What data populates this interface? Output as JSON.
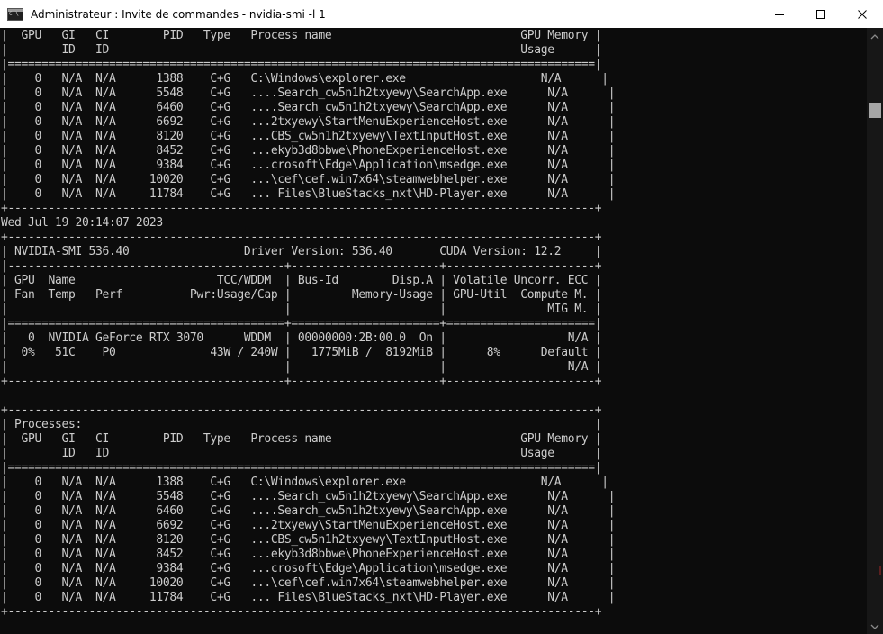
{
  "window": {
    "title": "Administrateur : Invite de commandes - nvidia-smi  -l 1"
  },
  "terminal": {
    "lines": [
      "|  GPU   GI   CI        PID   Type   Process name                            GPU Memory |",
      "|        ID   ID                                                             Usage      |",
      "|=======================================================================================|",
      "|    0   N/A  N/A      1388    C+G   C:\\Windows\\explorer.exe                    N/A      |",
      "|    0   N/A  N/A      5548    C+G   ....Search_cw5n1h2txyewy\\SearchApp.exe      N/A      |",
      "|    0   N/A  N/A      6460    C+G   ....Search_cw5n1h2txyewy\\SearchApp.exe      N/A      |",
      "|    0   N/A  N/A      6692    C+G   ...2txyewy\\StartMenuExperienceHost.exe      N/A      |",
      "|    0   N/A  N/A      8120    C+G   ...CBS_cw5n1h2txyewy\\TextInputHost.exe      N/A      |",
      "|    0   N/A  N/A      8452    C+G   ...ekyb3d8bbwe\\PhoneExperienceHost.exe      N/A      |",
      "|    0   N/A  N/A      9384    C+G   ...crosoft\\Edge\\Application\\msedge.exe      N/A      |",
      "|    0   N/A  N/A     10020    C+G   ...\\cef\\cef.win7x64\\steamwebhelper.exe      N/A      |",
      "|    0   N/A  N/A     11784    C+G   ... Files\\BlueStacks_nxt\\HD-Player.exe      N/A      |",
      "+---------------------------------------------------------------------------------------+",
      "Wed Jul 19 20:14:07 2023",
      "+---------------------------------------------------------------------------------------+",
      "| NVIDIA-SMI 536.40                 Driver Version: 536.40       CUDA Version: 12.2     |",
      "|-----------------------------------------+----------------------+----------------------+",
      "| GPU  Name                     TCC/WDDM  | Bus-Id        Disp.A | Volatile Uncorr. ECC |",
      "| Fan  Temp   Perf          Pwr:Usage/Cap |         Memory-Usage | GPU-Util  Compute M. |",
      "|                                         |                      |               MIG M. |",
      "|=========================================+======================+======================|",
      "|   0  NVIDIA GeForce RTX 3070      WDDM  | 00000000:2B:00.0  On |                  N/A |",
      "|  0%   51C    P0              43W / 240W |   1775MiB /  8192MiB |      8%      Default |",
      "|                                         |                      |                  N/A |",
      "+-----------------------------------------+----------------------+----------------------+",
      "",
      "+---------------------------------------------------------------------------------------+",
      "| Processes:                                                                            |",
      "|  GPU   GI   CI        PID   Type   Process name                            GPU Memory |",
      "|        ID   ID                                                             Usage      |",
      "|=======================================================================================|",
      "|    0   N/A  N/A      1388    C+G   C:\\Windows\\explorer.exe                    N/A      |",
      "|    0   N/A  N/A      5548    C+G   ....Search_cw5n1h2txyewy\\SearchApp.exe      N/A      |",
      "|    0   N/A  N/A      6460    C+G   ....Search_cw5n1h2txyewy\\SearchApp.exe      N/A      |",
      "|    0   N/A  N/A      6692    C+G   ...2txyewy\\StartMenuExperienceHost.exe      N/A      |",
      "|    0   N/A  N/A      8120    C+G   ...CBS_cw5n1h2txyewy\\TextInputHost.exe      N/A      |",
      "|    0   N/A  N/A      8452    C+G   ...ekyb3d8bbwe\\PhoneExperienceHost.exe      N/A      |",
      "|    0   N/A  N/A      9384    C+G   ...crosoft\\Edge\\Application\\msedge.exe      N/A      |",
      "|    0   N/A  N/A     10020    C+G   ...\\cef\\cef.win7x64\\steamwebhelper.exe      N/A      |",
      "|    0   N/A  N/A     11784    C+G   ... Files\\BlueStacks_nxt\\HD-Player.exe      N/A      |",
      "+---------------------------------------------------------------------------------------+"
    ]
  },
  "icons": {
    "app": "console-icon",
    "minimize": "minimize-icon",
    "maximize": "maximize-icon",
    "close": "close-icon",
    "scroll_up": "chevron-up-icon",
    "scroll_down": "chevron-down-icon"
  },
  "colors": {
    "background": "#0c0c0c",
    "foreground": "#cccccc",
    "titlebar": "#ffffff",
    "scrollbar_track": "#171717",
    "scrollbar_thumb": "#a6a6a6"
  }
}
